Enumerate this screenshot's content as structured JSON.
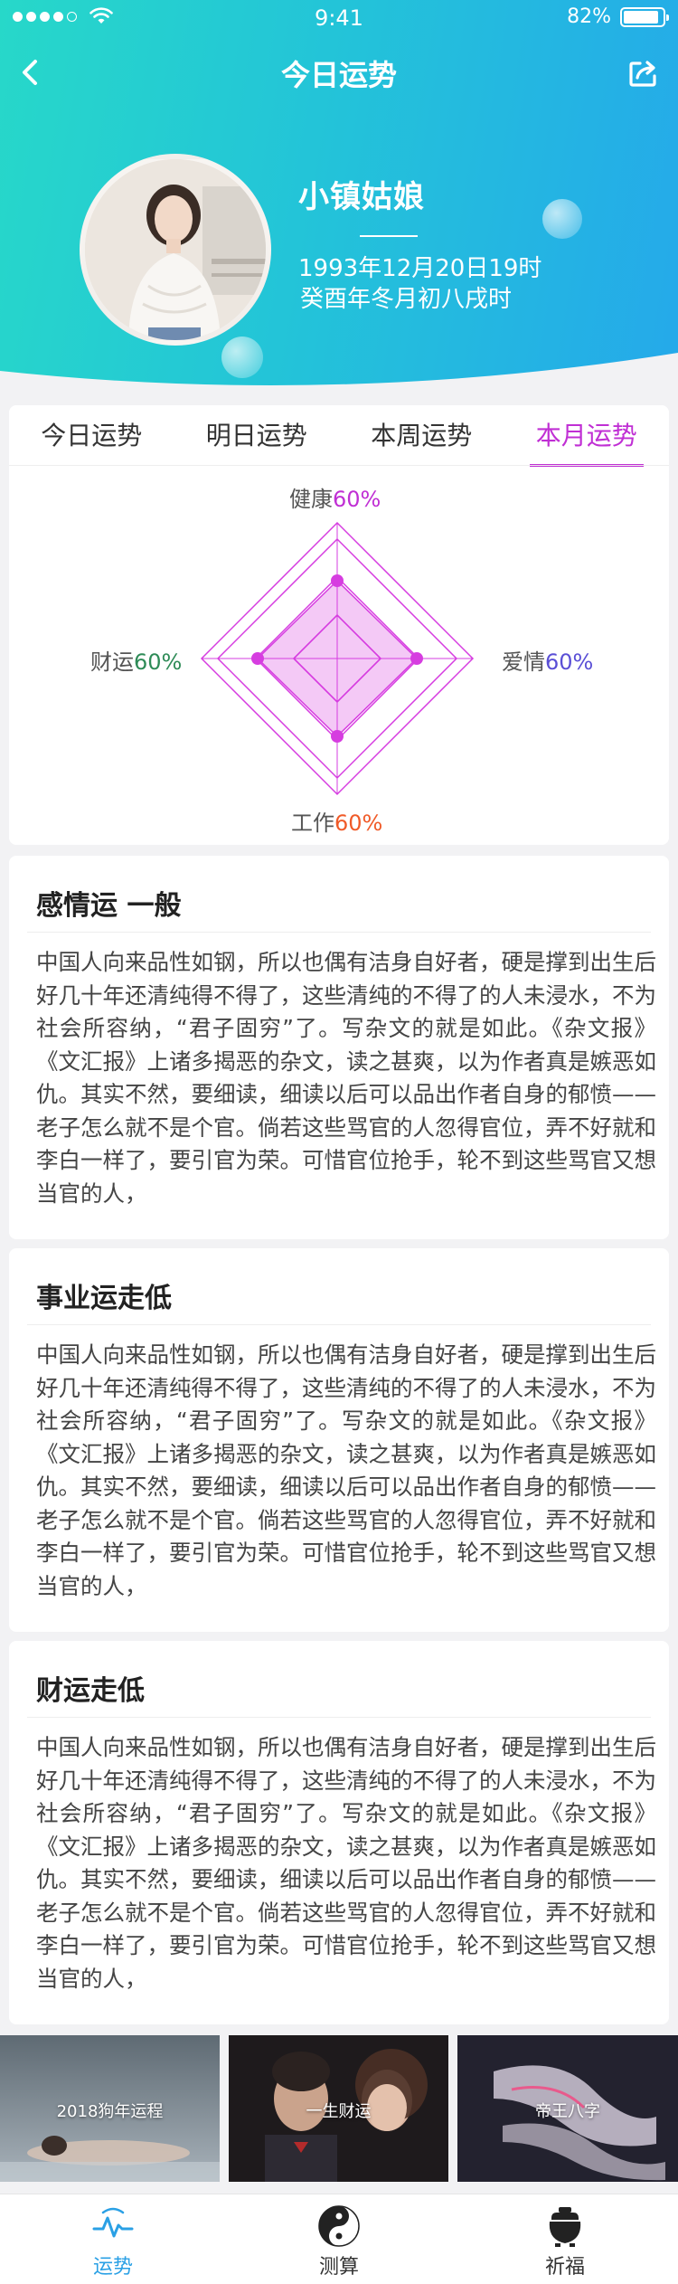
{
  "status_bar": {
    "time": "9:41",
    "battery": "82%"
  },
  "nav": {
    "title": "今日运势"
  },
  "profile": {
    "name": "小镇姑娘",
    "birth_date": "1993年12月20日19时",
    "lunar_date": "癸酉年冬月初八戌时"
  },
  "tabs": [
    {
      "label": "今日运势",
      "active": false
    },
    {
      "label": "明日运势",
      "active": false
    },
    {
      "label": "本周运势",
      "active": false
    },
    {
      "label": "本月运势",
      "active": true
    }
  ],
  "radar": {
    "top": {
      "name": "健康",
      "value": "60%",
      "color": "#c02fd4"
    },
    "right": {
      "name": "爱情",
      "value": "60%",
      "color": "#5a4fd6"
    },
    "bottom": {
      "name": "工作",
      "value": "60%",
      "color": "#f05a28"
    },
    "left": {
      "name": "财运",
      "value": "60%",
      "color": "#2e8b57"
    },
    "accent": "#d63de0"
  },
  "sections": [
    {
      "title": "感情运 一般",
      "body": "中国人向来品性如钢，所以也偶有洁身自好者，硬是撑到出生后好几十年还清纯得不得了，这些清纯的不得了的人未浸水，不为社会所容纳，“君子固穷”了。写杂文的就是如此。《杂文报》《文汇报》上诸多揭恶的杂文，读之甚爽，以为作者真是嫉恶如仇。其实不然，要细读，细读以后可以品出作者自身的郁愤——老子怎么就不是个官。倘若这些骂官的人忽得官位，弄不好就和李白一样了，要引官为荣。可惜官位抢手，轮不到这些骂官又想当官的人，"
    },
    {
      "title": "事业运走低",
      "body": "中国人向来品性如钢，所以也偶有洁身自好者，硬是撑到出生后好几十年还清纯得不得了，这些清纯的不得了的人未浸水，不为社会所容纳，“君子固穷”了。写杂文的就是如此。《杂文报》《文汇报》上诸多揭恶的杂文，读之甚爽，以为作者真是嫉恶如仇。其实不然，要细读，细读以后可以品出作者自身的郁愤——老子怎么就不是个官。倘若这些骂官的人忽得官位，弄不好就和李白一样了，要引官为荣。可惜官位抢手，轮不到这些骂官又想当官的人，"
    },
    {
      "title": "财运走低",
      "body": "中国人向来品性如钢，所以也偶有洁身自好者，硬是撑到出生后好几十年还清纯得不得了，这些清纯的不得了的人未浸水，不为社会所容纳，“君子固穷”了。写杂文的就是如此。《杂文报》《文汇报》上诸多揭恶的杂文，读之甚爽，以为作者真是嫉恶如仇。其实不然，要细读，细读以后可以品出作者自身的郁愤——老子怎么就不是个官。倘若这些骂官的人忽得官位，弄不好就和李白一样了，要引官为荣。可惜官位抢手，轮不到这些骂官又想当官的人，"
    }
  ],
  "promos": [
    {
      "label": "2018狗年运程"
    },
    {
      "label": "一生财运"
    },
    {
      "label": "帝王八字"
    }
  ],
  "tabbar": [
    {
      "label": "运势",
      "icon": "pulse-icon",
      "active": true
    },
    {
      "label": "测算",
      "icon": "yin-yang-icon",
      "active": false
    },
    {
      "label": "祈福",
      "icon": "incense-pot-icon",
      "active": false
    }
  ],
  "colors": {
    "header_start": "#27d8c9",
    "header_end": "#25a9ea",
    "active_tab": "#c02fd4",
    "tabbar_active": "#2aa0e5"
  }
}
